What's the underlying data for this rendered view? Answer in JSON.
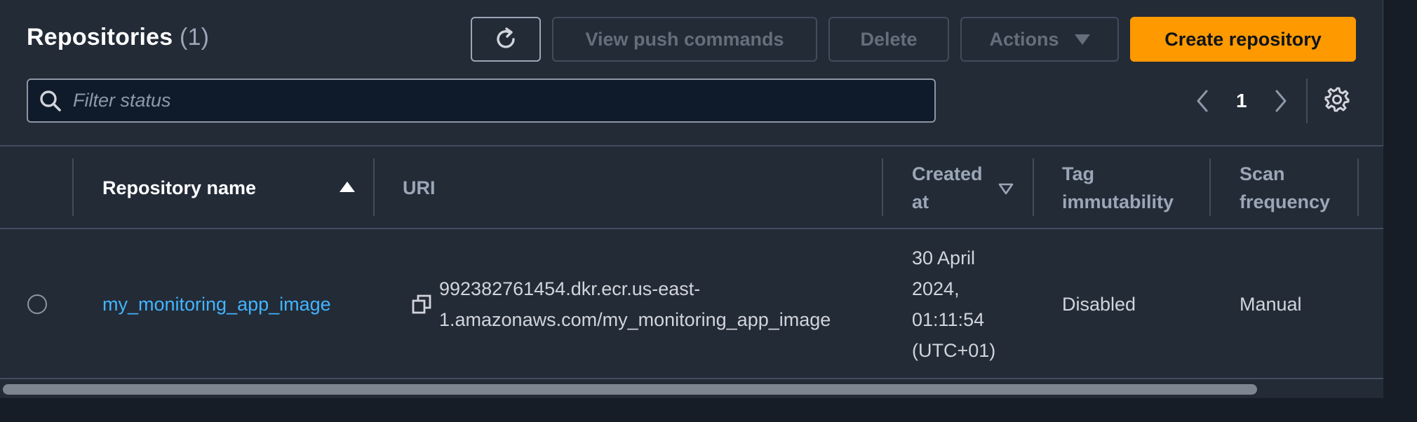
{
  "header": {
    "title": "Repositories",
    "count": "(1)",
    "buttons": {
      "view_push_commands": "View push commands",
      "delete": "Delete",
      "actions": "Actions",
      "create_repository": "Create repository"
    }
  },
  "filter": {
    "placeholder": "Filter status",
    "value": ""
  },
  "pagination": {
    "current_page": "1"
  },
  "table": {
    "columns": {
      "name": "Repository name",
      "uri": "URI",
      "created_at_1": "Created",
      "created_at_2": "at",
      "tag_immutability_1": "Tag",
      "tag_immutability_2": "immutability",
      "scan_frequency_1": "Scan",
      "scan_frequency_2": "frequency"
    },
    "rows": [
      {
        "name": "my_monitoring_app_image",
        "uri_line1": "992382761454.dkr.ecr.us-east-",
        "uri_line2": "1.amazonaws.com/my_monitoring_app_image",
        "created_line1": "30 April",
        "created_line2": "2024,",
        "created_line3": "01:11:54",
        "created_line4": "(UTC+01)",
        "tag_immutability": "Disabled",
        "scan_frequency": "Manual"
      }
    ]
  },
  "colors": {
    "accent": "#ff9900",
    "link": "#42b4ff",
    "panel": "#232b37",
    "background": "#161d26"
  },
  "icons": [
    "refresh-icon",
    "search-icon",
    "chevron-left-icon",
    "chevron-right-icon",
    "gear-icon",
    "sort-ascending-icon",
    "sort-descending-icon",
    "copy-icon",
    "radio-button"
  ]
}
